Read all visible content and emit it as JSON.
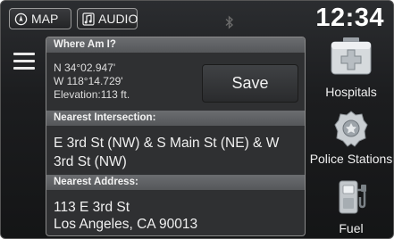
{
  "topbar": {
    "map_label": "MAP",
    "audio_label": "AUDIO",
    "clock": "12:34"
  },
  "where_am_i": {
    "header": "Where Am I?",
    "latitude": "N 34°02.947'",
    "longitude": "W 118°14.729'",
    "elevation": "Elevation:113 ft.",
    "save_label": "Save"
  },
  "nearest_intersection": {
    "header": "Nearest Intersection:",
    "value": "E 3rd St (NW) & S Main St (NE) & W 3rd St (NW)"
  },
  "nearest_address": {
    "header": "Nearest Address:",
    "line1": "113 E 3rd St",
    "line2": "Los Angeles, CA 90013"
  },
  "categories": [
    {
      "label": "Hospitals",
      "icon": "hospital-icon"
    },
    {
      "label": "Police Stations",
      "icon": "police-badge-icon"
    },
    {
      "label": "Fuel",
      "icon": "fuel-pump-icon"
    }
  ]
}
